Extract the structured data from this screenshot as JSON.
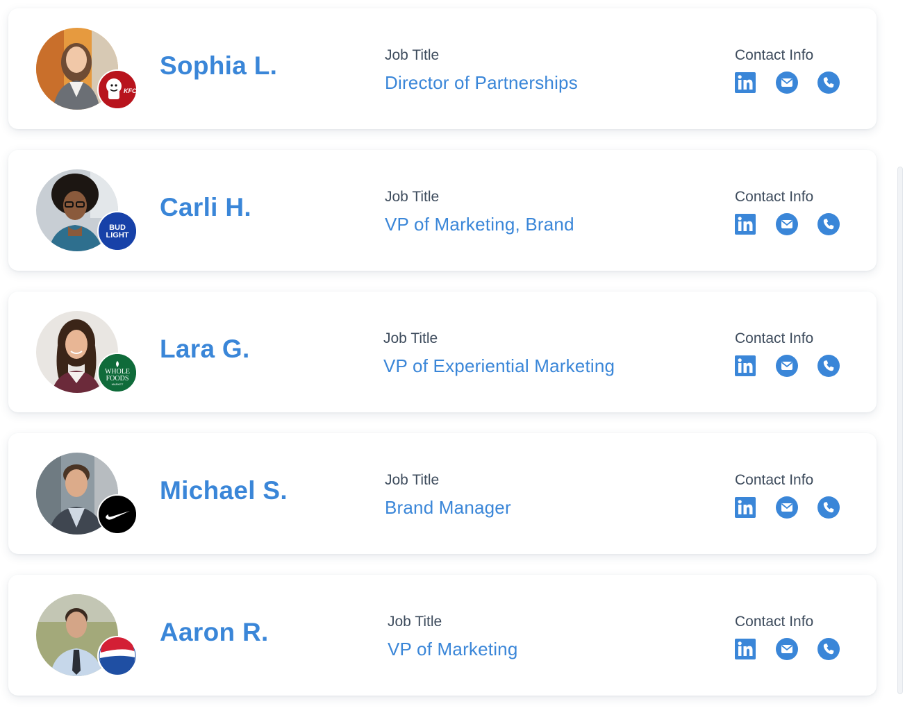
{
  "labels": {
    "job_title": "Job Title",
    "contact_info": "Contact Info"
  },
  "colors": {
    "accent": "#3a86d8",
    "label": "#3d4b5c"
  },
  "people": [
    {
      "name": "Sophia L.",
      "job_title": "Director of Partnerships",
      "brand": "KFC",
      "brand_icon": "kfc-logo",
      "avatar_bg": "#e69a3f"
    },
    {
      "name": "Carli H.",
      "job_title": "VP of Marketing, Brand",
      "brand": "BUD LIGHT",
      "brand_icon": "bud-light-logo",
      "avatar_bg": "#c8ced4"
    },
    {
      "name": "Lara G.",
      "job_title": "VP of Experiential Marketing",
      "brand": "WHOLE FOODS MARKET",
      "brand_icon": "whole-foods-logo",
      "avatar_bg": "#e9e6e2"
    },
    {
      "name": "Michael S.",
      "job_title": "Brand Manager",
      "brand": "Nike",
      "brand_icon": "nike-logo",
      "avatar_bg": "#8e9aa2"
    },
    {
      "name": "Aaron R.",
      "job_title": "VP of Marketing",
      "brand": "Pepsi",
      "brand_icon": "pepsi-logo",
      "avatar_bg": "#a3a97a"
    }
  ]
}
